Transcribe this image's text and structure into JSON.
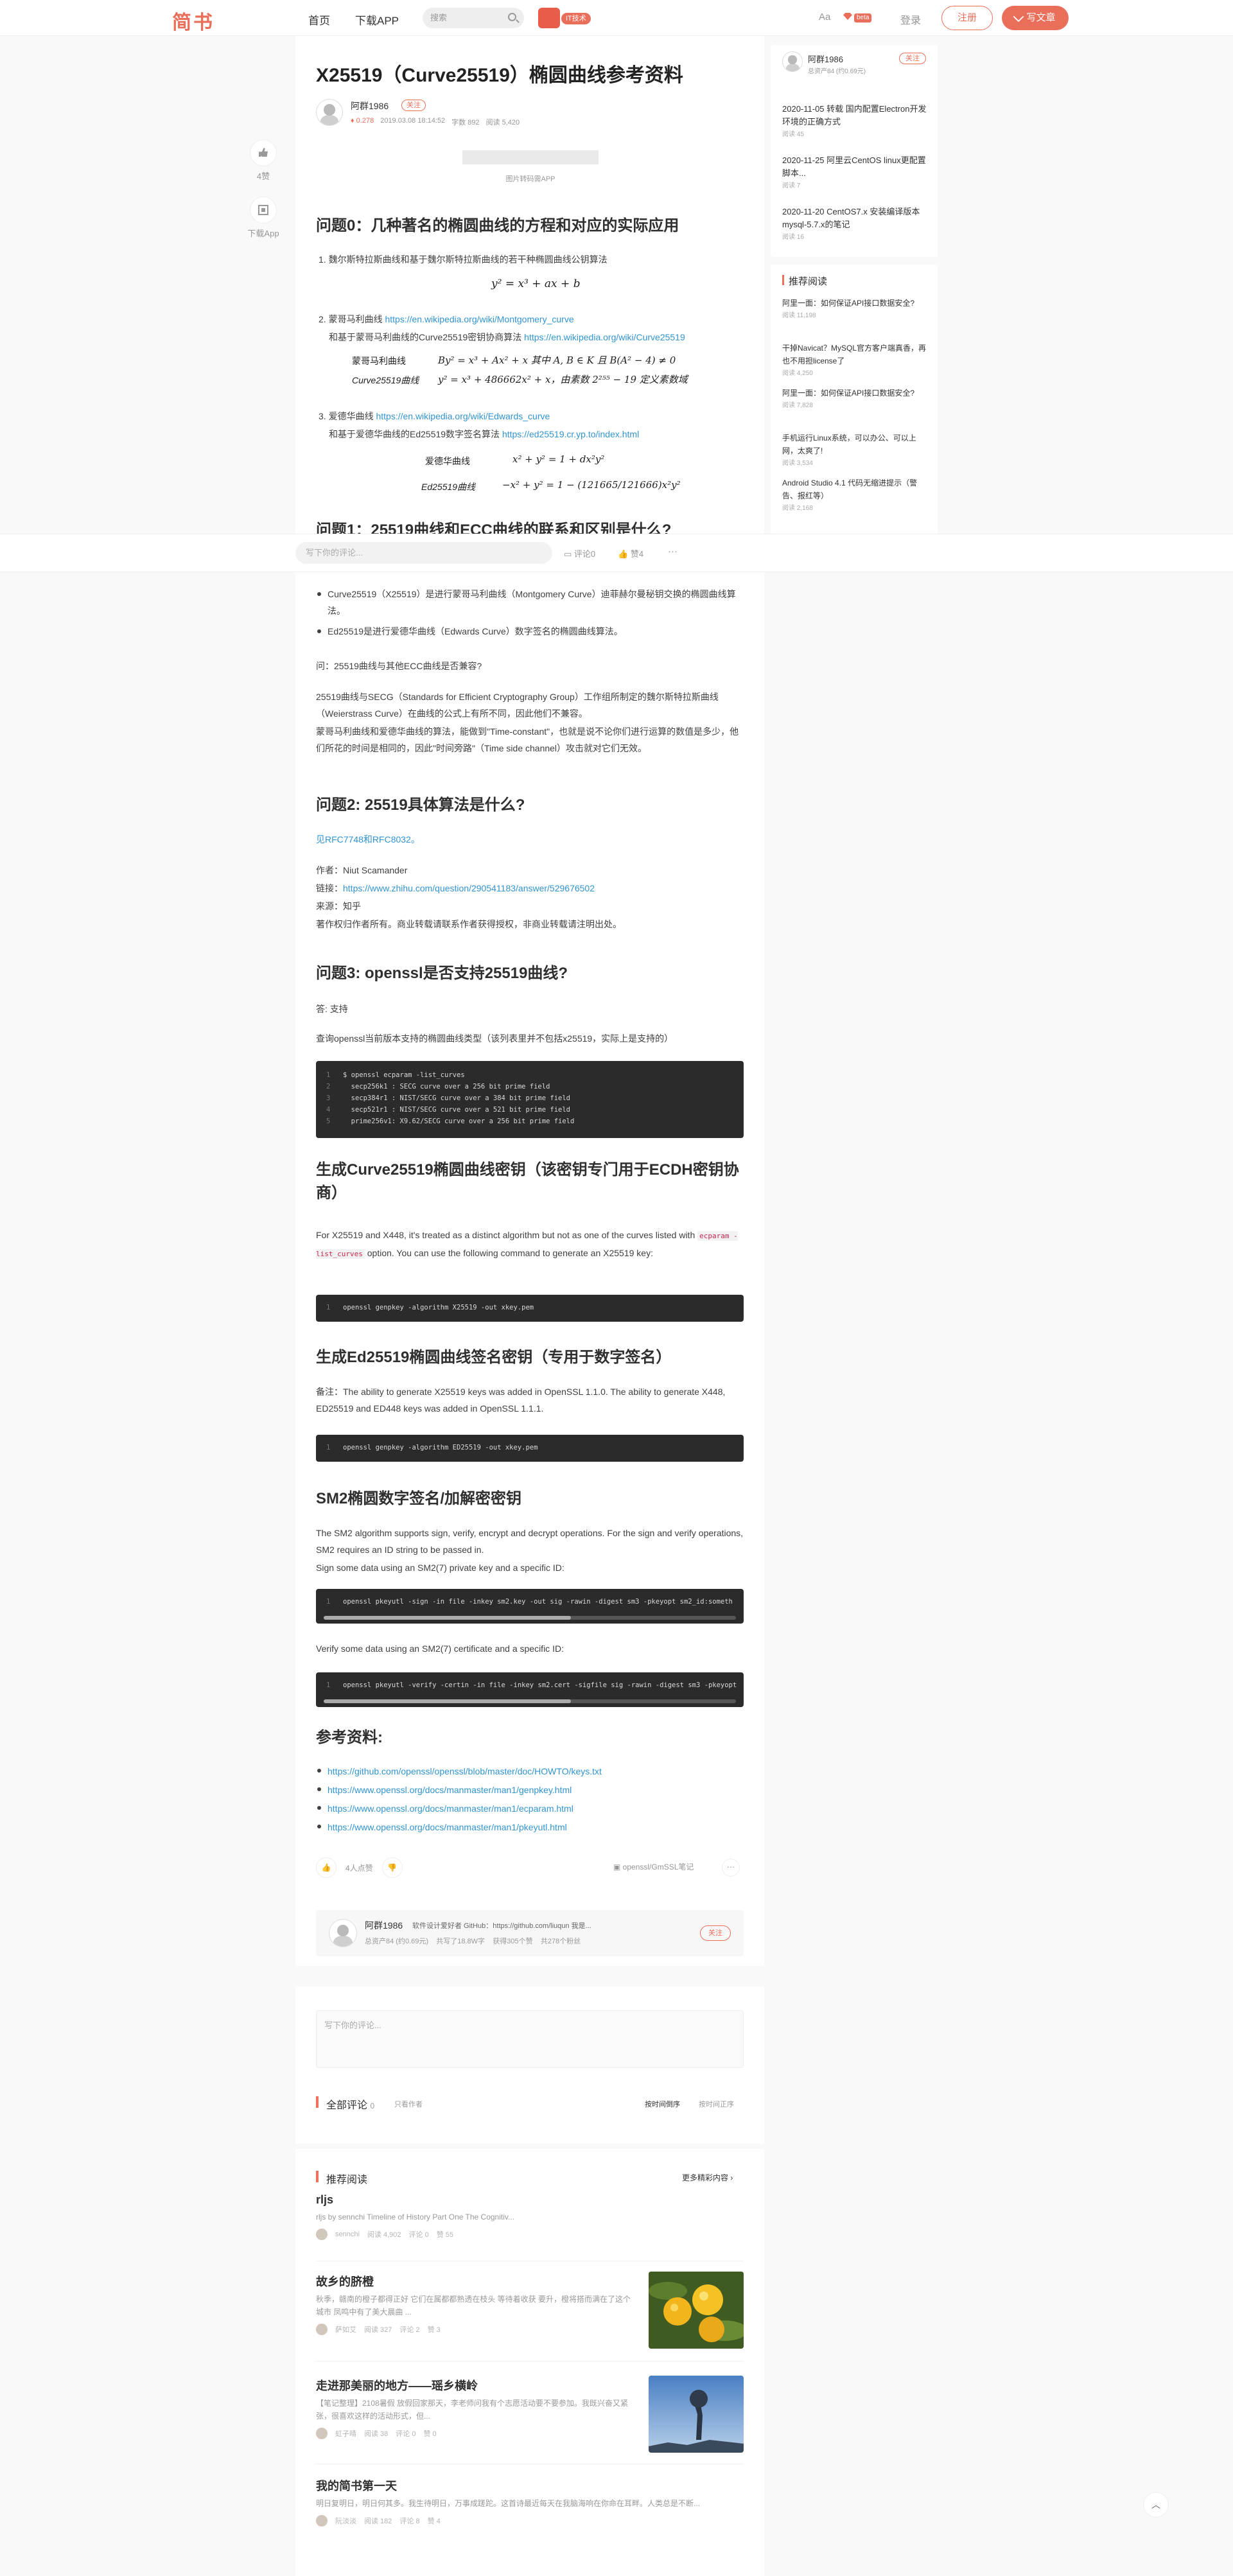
{
  "header": {
    "logo": "简书",
    "nav_home": "首页",
    "nav_app": "下载APP",
    "search_placeholder": "搜索",
    "promo_tag": "IT技术",
    "aa": "Aa",
    "beta": "beta",
    "login": "登录",
    "signup": "注册",
    "write": "写文章"
  },
  "article": {
    "title": "X25519（Curve25519）椭圆曲线参考资料",
    "author": "阿群1986",
    "follow": "关注",
    "meta": {
      "diamond": "0.278",
      "date": "2019.03.08 18:14:52",
      "words": "字数 892",
      "reads": "阅读 5,420"
    },
    "image_caption": "图片转码需APP",
    "side_like_count": "4赞",
    "side_app": "下载App",
    "q0_title": "问题0：几种著名的椭圆曲线的方程和对应的实际应用",
    "q0_item1": "1. 魏尔斯特拉斯曲线和基于魏尔斯特拉斯曲线的若干种椭圆曲线公钥算法",
    "eq1": "y² = x³ + ax + b",
    "q0_item2_pre": "2. 蒙哥马利曲线 ",
    "q0_item2_link": "https://en.wikipedia.org/wiki/Montgomery_curve",
    "q0_item2_sub": "和基于蒙哥马利曲线的Curve25519密钥协商算法 ",
    "q0_item2_sub_link": "https://en.wikipedia.org/wiki/Curve25519",
    "eq2a_label": "蒙哥马利曲线",
    "eq2a": "By² = x³ + Ax² + x 其中 A, B ∈ K 且 B(A² − 4) ≠ 0",
    "eq2b_label": "Curve25519曲线",
    "eq2b": "y² = x³ + 486662x² + x，由素数 2²⁵⁵ − 19 定义素数域",
    "q0_item3_pre": "3. 爱德华曲线 ",
    "q0_item3_link": "https://en.wikipedia.org/wiki/Edwards_curve",
    "q0_item3_sub": "和基于爱德华曲线的Ed25519数字签名算法 ",
    "q0_item3_sub_link": "https://ed25519.cr.yp.to/index.html",
    "eq3a_label": "爱德华曲线",
    "eq3a": "x² + y² = 1 + dx²y²",
    "eq3b_label": "Ed25519曲线",
    "eq3b": "−x² + y² = 1 − (121665/121666)x²y²",
    "q1_title": "问题1：25519曲线和ECC曲线的联系和区别是什么?",
    "q1_b1": "Curve25519（X25519）是进行蒙哥马利曲线（Montgomery Curve）迪菲赫尔曼秘钥交换的椭圆曲线算法。",
    "q1_b2": "Ed25519是进行爱德华曲线（Edwards Curve）数字签名的椭圆曲线算法。",
    "q1_ask": "问：25519曲线与其他ECC曲线是否兼容?",
    "q1_p1": "25519曲线与SECG（Standards for Efficient Cryptography Group）工作组所制定的魏尔斯特拉斯曲线（Weierstrass Curve）在曲线的公式上有所不同，因此他们不兼容。",
    "q1_p2": "蒙哥马利曲线和爱德华曲线的算法，能做到\"Time-constant\"，也就是说不论你们进行运算的数值是多少，他们所花的时间是相同的，因此\"时间旁路\"（Time side channel）攻击就对它们无效。",
    "q2_title": "问题2: 25519具体算法是什么?",
    "q2_see": "见RFC7748和RFC8032。",
    "q2_author": "作者：Niut Scamander",
    "q2_link_label": "链接：",
    "q2_link": "https://www.zhihu.com/question/290541183/answer/529676502",
    "q2_source": "来源：知乎",
    "q2_copyright": "著作权归作者所有。商业转载请联系作者获得授权，非商业转载请注明出处。",
    "q3_title": "问题3: openssl是否支持25519曲线?",
    "q3_answer": "答: 支持",
    "q3_p": "查询openssl当前版本支持的椭圆曲线类型（该列表里并不包括x25519，实际上是支持的）",
    "code1": [
      "$ openssl ecparam -list_curves",
      "  secp256k1 : SECG curve over a 256 bit prime field",
      "  secp384r1 : NIST/SECG curve over a 384 bit prime field",
      "  secp521r1 : NIST/SECG curve over a 521 bit prime field",
      "  prime256v1: X9.62/SECG curve over a 256 bit prime field"
    ],
    "gen_x_title": "生成Curve25519椭圆曲线密钥（该密钥专门用于ECDH密钥协商）",
    "gen_x_p1": "For X25519 and X448, it's treated as a distinct algorithm but not as one of the curves listed with ",
    "gen_x_inline": "ecparam -list_curves",
    "gen_x_p2": " option. You can use the following command to generate an X25519 key:",
    "code2": "openssl genpkey -algorithm X25519 -out xkey.pem",
    "gen_ed_title": "生成Ed25519椭圆曲线签名密钥（专用于数字签名）",
    "gen_ed_p": "备注：The ability to generate X25519 keys was added in OpenSSL 1.1.0. The ability to generate X448, ED25519 and ED448 keys was added in OpenSSL 1.1.1.",
    "code3": "openssl genpkey -algorithm ED25519 -out xkey.pem",
    "sm2_title": "SM2椭圆数字签名/加解密密钥",
    "sm2_p1": "The SM2 algorithm supports sign, verify, encrypt and decrypt operations. For the sign and verify operations, SM2 requires an ID string to be passed in.",
    "sm2_p2": "Sign some data using an SM2(7) private key and a specific ID:",
    "code4": "openssl pkeyutl -sign -in file -inkey sm2.key -out sig -rawin -digest sm3 -pkeyopt sm2_id:someth",
    "sm2_p3": "Verify some data using an SM2(7) certificate and a specific ID:",
    "code5": "openssl pkeyutl -verify -certin -in file -inkey sm2.cert -sigfile sig -rawin -digest sm3 -pkeyopt",
    "ref_title": "参考资料:",
    "refs": [
      "https://github.com/openssl/openssl/blob/master/doc/HOWTO/keys.txt",
      "https://www.openssl.org/docs/manmaster/man1/genpkey.html",
      "https://www.openssl.org/docs/manmaster/man1/ecparam.html",
      "https://www.openssl.org/docs/manmaster/man1/pkeyutl.html"
    ],
    "likes_text": "4人点赞",
    "collection": "openssl/GmSSL笔记"
  },
  "author_card": {
    "name": "阿群1986",
    "bio": "软件设计爱好者 GitHub：https://github.com/liuqun 我是...",
    "stats": "总资产84 (约0.69元)    共写了18.8W字    获得305个赞    共278个粉丝",
    "follow": "关注"
  },
  "sidebar": {
    "author": "阿群1986",
    "assets": "总资产84 (约0.69元)",
    "follow": "关注",
    "posts": [
      {
        "title": "2020-11-05 转载 国内配置Electron开发环境的正确方式",
        "reads": "阅读 45"
      },
      {
        "title": "2020-11-25 阿里云CentOS linux更配置脚本...",
        "reads": "阅读 7"
      },
      {
        "title": "2020-11-20 CentOS7.x 安装编译版本mysql-5.7.x的笔记",
        "reads": "阅读 16"
      }
    ],
    "rec_title": "推荐阅读",
    "recs": [
      {
        "title": "阿里一面：如何保证API接口数据安全?",
        "reads": "阅读 11,198"
      },
      {
        "title": "干掉Navicat？MySQL官方客户端真香，再也不用担license了",
        "reads": "阅读 4,250"
      },
      {
        "title": "阿里一面：如何保证API接口数据安全?",
        "reads": "阅读 7,828"
      },
      {
        "title": "手机运行Linux系统，可以办公、可以上网，太爽了!",
        "reads": "阅读 3,534"
      },
      {
        "title": "Android Studio 4.1 代码无缩进提示（警告、报红等）",
        "reads": "阅读 2,168"
      }
    ]
  },
  "comment_bar": {
    "placeholder": "写下你的评论...",
    "comment": "评论0",
    "likes": "赞4",
    "more": "···"
  },
  "comments": {
    "placeholder": "写下你的评论...",
    "title": "全部评论",
    "count": "0",
    "author_only": "只看作者",
    "sort_time": "按时间倒序",
    "sort_time2": "按时间正序"
  },
  "feed": {
    "title": "推荐阅读",
    "more": "更多精彩内容",
    "items": [
      {
        "title": "rljs",
        "desc": "rljs by sennchi Timeline of History Part One The Cognitiv...",
        "author": "sennchi",
        "reads": "阅读 4,902",
        "comments": "评论 0",
        "likes": "赞 55"
      },
      {
        "title": "故乡的脐橙",
        "desc": "秋季，赣南的橙子都得正好 它们在属都都熟透在枝头 等待着收获 要升，橙将搭而满在了这个城市 凤鸣中有了美大晨曲 ...",
        "author": "萨如艾",
        "reads": "阅读 327",
        "comments": "评论 2",
        "likes": "赞 3"
      },
      {
        "title": "走进那美丽的地方——瑶乡横岭",
        "desc": "【笔记整理】2108暑假 放假回家那天，李老师问我有个志愿活动要不要参加。我既兴奋又紧张，很喜欢这样的活动形式，但...",
        "author": "虹子晴",
        "reads": "阅读 38",
        "comments": "评论 0",
        "likes": "赞 0"
      },
      {
        "title": "我的简书第一天",
        "desc": "明日复明日，明日何其多。我生待明日，万事成蹉跎。这首诗最近每天在我脑海响在你命在耳畔。人类总是不断...",
        "author": "阮淡淡",
        "reads": "阅读 182",
        "comments": "评论 8",
        "likes": "赞 4"
      }
    ]
  }
}
